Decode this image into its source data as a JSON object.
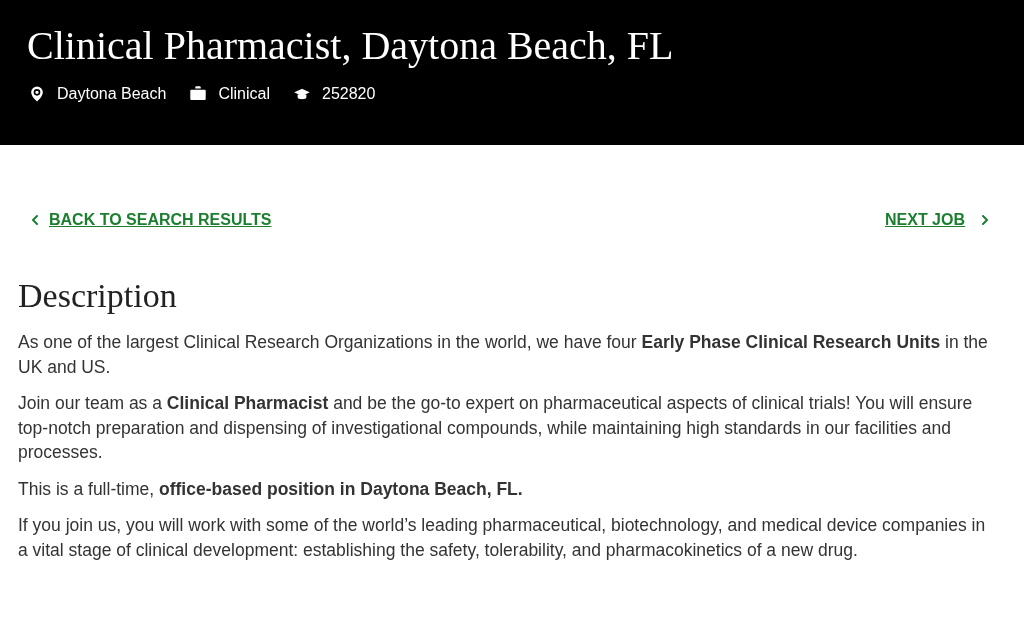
{
  "header": {
    "title": "Clinical Pharmacist, Daytona Beach, FL",
    "meta": [
      {
        "kind": "location",
        "text": "Daytona Beach"
      },
      {
        "kind": "category",
        "text": "Clinical"
      },
      {
        "kind": "id",
        "text": "252820"
      }
    ]
  },
  "nav": {
    "back": "BACK TO SEARCH RESULTS",
    "next": "NEXT JOB"
  },
  "description": {
    "heading": "Description",
    "paragraphs": [
      "As one of the largest Clinical Research Organizations in the world, we have four **Early Phase Clinical Research Units** in the UK and US.",
      "Join our team as a **Clinical Pharmacist** and be the go-to expert on pharmaceutical aspects of clinical trials! You will ensure top-notch preparation and dispensing of investigational compounds, while maintaining high standards in our facilities and processes.",
      "This is a full-time, **office-based position in Daytona Beach, FL.**",
      "If you join us, you will work with some of the world’s leading pharmaceutical, biotechnology, and medical device companies in a vital stage of clinical development: establishing the safety, tolerability, and pharmacokinetics of a new drug."
    ]
  }
}
